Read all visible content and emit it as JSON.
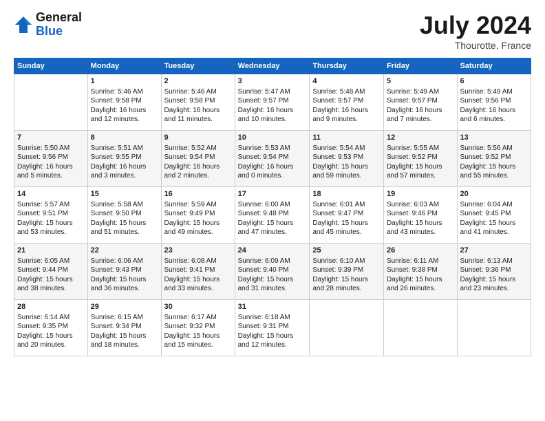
{
  "header": {
    "logo_line1": "General",
    "logo_line2": "Blue",
    "month_year": "July 2024",
    "location": "Thourotte, France"
  },
  "columns": [
    "Sunday",
    "Monday",
    "Tuesday",
    "Wednesday",
    "Thursday",
    "Friday",
    "Saturday"
  ],
  "weeks": [
    [
      {
        "day": "",
        "info": ""
      },
      {
        "day": "1",
        "info": "Sunrise: 5:46 AM\nSunset: 9:58 PM\nDaylight: 16 hours\nand 12 minutes."
      },
      {
        "day": "2",
        "info": "Sunrise: 5:46 AM\nSunset: 9:58 PM\nDaylight: 16 hours\nand 11 minutes."
      },
      {
        "day": "3",
        "info": "Sunrise: 5:47 AM\nSunset: 9:57 PM\nDaylight: 16 hours\nand 10 minutes."
      },
      {
        "day": "4",
        "info": "Sunrise: 5:48 AM\nSunset: 9:57 PM\nDaylight: 16 hours\nand 9 minutes."
      },
      {
        "day": "5",
        "info": "Sunrise: 5:49 AM\nSunset: 9:57 PM\nDaylight: 16 hours\nand 7 minutes."
      },
      {
        "day": "6",
        "info": "Sunrise: 5:49 AM\nSunset: 9:56 PM\nDaylight: 16 hours\nand 6 minutes."
      }
    ],
    [
      {
        "day": "7",
        "info": "Sunrise: 5:50 AM\nSunset: 9:56 PM\nDaylight: 16 hours\nand 5 minutes."
      },
      {
        "day": "8",
        "info": "Sunrise: 5:51 AM\nSunset: 9:55 PM\nDaylight: 16 hours\nand 3 minutes."
      },
      {
        "day": "9",
        "info": "Sunrise: 5:52 AM\nSunset: 9:54 PM\nDaylight: 16 hours\nand 2 minutes."
      },
      {
        "day": "10",
        "info": "Sunrise: 5:53 AM\nSunset: 9:54 PM\nDaylight: 16 hours\nand 0 minutes."
      },
      {
        "day": "11",
        "info": "Sunrise: 5:54 AM\nSunset: 9:53 PM\nDaylight: 15 hours\nand 59 minutes."
      },
      {
        "day": "12",
        "info": "Sunrise: 5:55 AM\nSunset: 9:52 PM\nDaylight: 15 hours\nand 57 minutes."
      },
      {
        "day": "13",
        "info": "Sunrise: 5:56 AM\nSunset: 9:52 PM\nDaylight: 15 hours\nand 55 minutes."
      }
    ],
    [
      {
        "day": "14",
        "info": "Sunrise: 5:57 AM\nSunset: 9:51 PM\nDaylight: 15 hours\nand 53 minutes."
      },
      {
        "day": "15",
        "info": "Sunrise: 5:58 AM\nSunset: 9:50 PM\nDaylight: 15 hours\nand 51 minutes."
      },
      {
        "day": "16",
        "info": "Sunrise: 5:59 AM\nSunset: 9:49 PM\nDaylight: 15 hours\nand 49 minutes."
      },
      {
        "day": "17",
        "info": "Sunrise: 6:00 AM\nSunset: 9:48 PM\nDaylight: 15 hours\nand 47 minutes."
      },
      {
        "day": "18",
        "info": "Sunrise: 6:01 AM\nSunset: 9:47 PM\nDaylight: 15 hours\nand 45 minutes."
      },
      {
        "day": "19",
        "info": "Sunrise: 6:03 AM\nSunset: 9:46 PM\nDaylight: 15 hours\nand 43 minutes."
      },
      {
        "day": "20",
        "info": "Sunrise: 6:04 AM\nSunset: 9:45 PM\nDaylight: 15 hours\nand 41 minutes."
      }
    ],
    [
      {
        "day": "21",
        "info": "Sunrise: 6:05 AM\nSunset: 9:44 PM\nDaylight: 15 hours\nand 38 minutes."
      },
      {
        "day": "22",
        "info": "Sunrise: 6:06 AM\nSunset: 9:43 PM\nDaylight: 15 hours\nand 36 minutes."
      },
      {
        "day": "23",
        "info": "Sunrise: 6:08 AM\nSunset: 9:41 PM\nDaylight: 15 hours\nand 33 minutes."
      },
      {
        "day": "24",
        "info": "Sunrise: 6:09 AM\nSunset: 9:40 PM\nDaylight: 15 hours\nand 31 minutes."
      },
      {
        "day": "25",
        "info": "Sunrise: 6:10 AM\nSunset: 9:39 PM\nDaylight: 15 hours\nand 28 minutes."
      },
      {
        "day": "26",
        "info": "Sunrise: 6:11 AM\nSunset: 9:38 PM\nDaylight: 15 hours\nand 26 minutes."
      },
      {
        "day": "27",
        "info": "Sunrise: 6:13 AM\nSunset: 9:36 PM\nDaylight: 15 hours\nand 23 minutes."
      }
    ],
    [
      {
        "day": "28",
        "info": "Sunrise: 6:14 AM\nSunset: 9:35 PM\nDaylight: 15 hours\nand 20 minutes."
      },
      {
        "day": "29",
        "info": "Sunrise: 6:15 AM\nSunset: 9:34 PM\nDaylight: 15 hours\nand 18 minutes."
      },
      {
        "day": "30",
        "info": "Sunrise: 6:17 AM\nSunset: 9:32 PM\nDaylight: 15 hours\nand 15 minutes."
      },
      {
        "day": "31",
        "info": "Sunrise: 6:18 AM\nSunset: 9:31 PM\nDaylight: 15 hours\nand 12 minutes."
      },
      {
        "day": "",
        "info": ""
      },
      {
        "day": "",
        "info": ""
      },
      {
        "day": "",
        "info": ""
      }
    ]
  ]
}
